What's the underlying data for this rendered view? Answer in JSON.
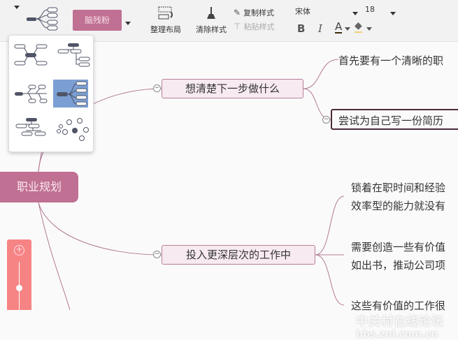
{
  "toolbar": {
    "theme_label": "脑残粉",
    "arrange_label": "整理布局",
    "clear_style_label": "清除样式",
    "copy_style_label": "复制样式",
    "paste_style_label": "粘贴样式",
    "font_family": "宋体",
    "font_size": "18",
    "bold_label": "B",
    "italic_label": "I",
    "font_color_label": "A"
  },
  "colors": {
    "accent": "#c07093",
    "zoom": "#f78484",
    "selected_layout": "#7b9fd3"
  },
  "mindmap": {
    "root": "职业规划",
    "branches": [
      {
        "label": "想清楚下一步做什么",
        "children": [
          "首先要有一个清晰的职",
          "尝试为自己写一份简历"
        ]
      },
      {
        "label": "投入更深层次的工作中",
        "children": [
          "锁着在职时间和经验",
          "效率型的能力就没有",
          "需要创造一些有价值",
          "如出书，推动公司项",
          "这些有价值的工作很"
        ]
      }
    ]
  },
  "watermark": {
    "line1": "中关村在线论坛",
    "line2": "bbs.zol.com.cn"
  }
}
